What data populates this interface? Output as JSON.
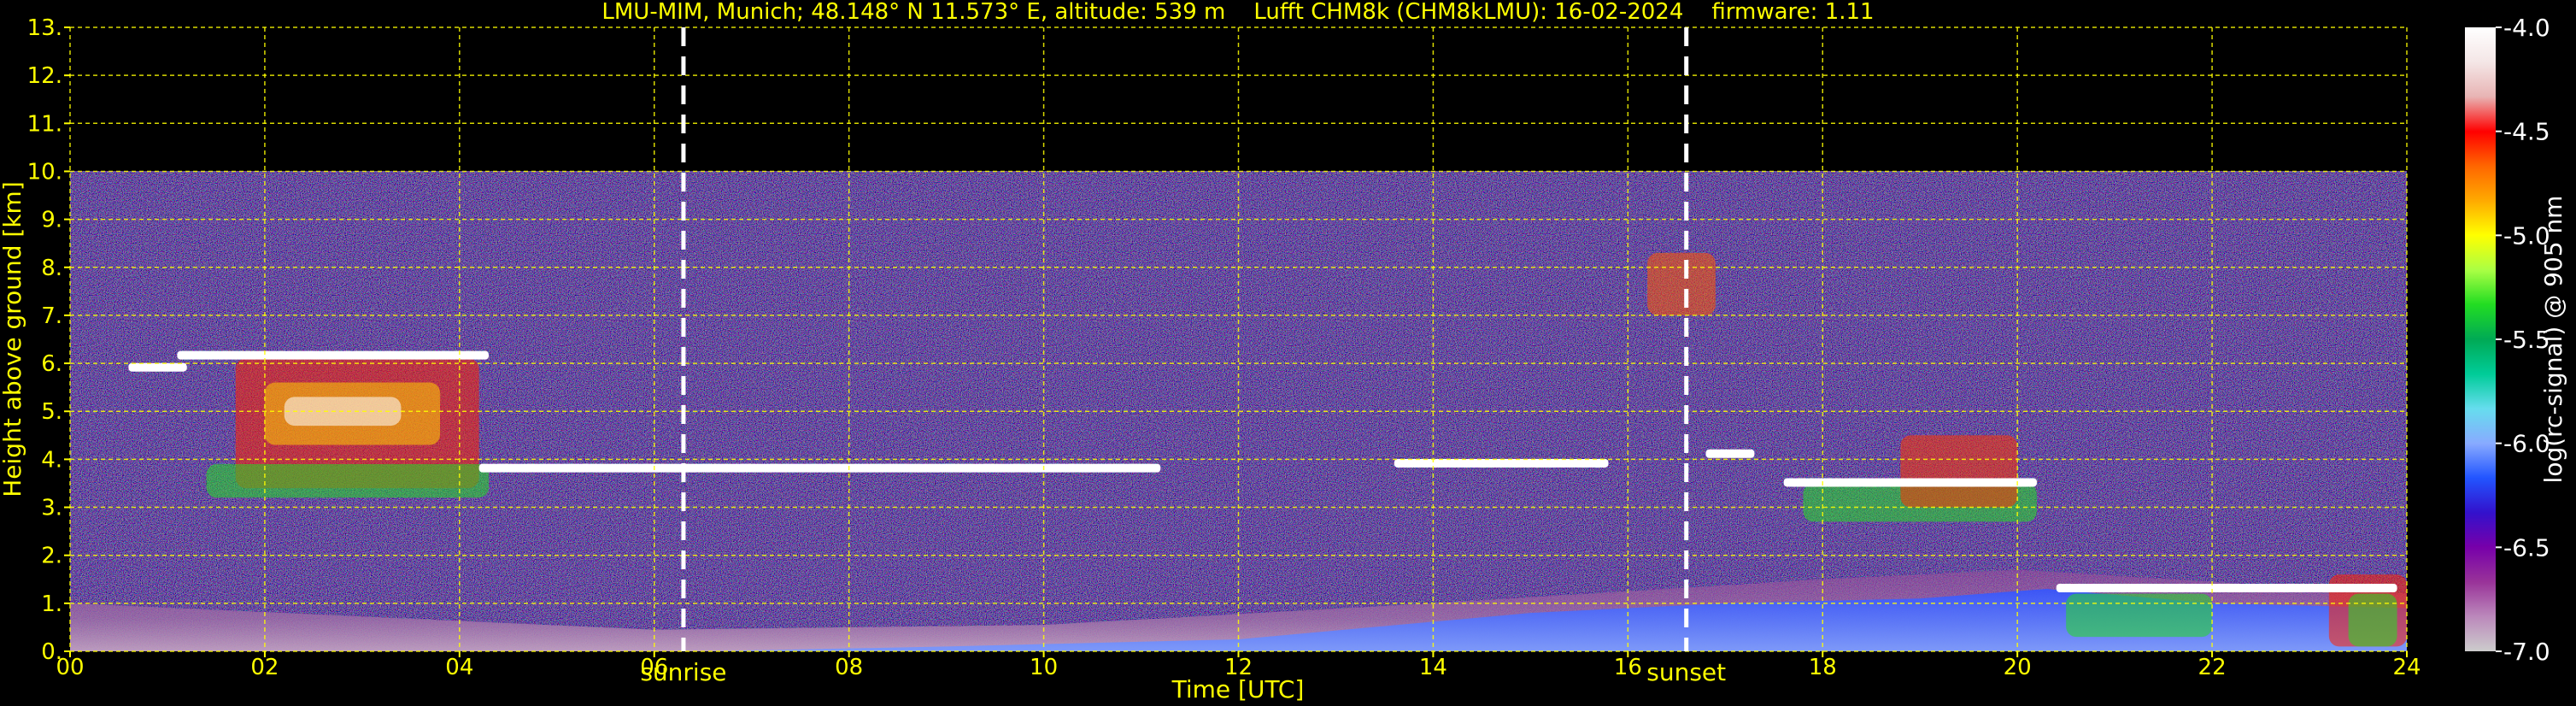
{
  "chart_data": {
    "type": "heatmap",
    "title": "LMU-MIM, Munich; 48.148° N 11.573° E, altitude: 539 m    Lufft CHM8k (CHM8kLMU): 16-02-2024    firmware: 1.11",
    "xlabel": "Time [UTC]",
    "ylabel": "Height above ground [km]",
    "xlim": [
      0,
      24
    ],
    "ylim": [
      0,
      13
    ],
    "x_ticks": [
      "00",
      "02",
      "04",
      "06",
      "08",
      "10",
      "12",
      "14",
      "16",
      "18",
      "20",
      "22",
      "24"
    ],
    "y_ticks": [
      "0.",
      "1.",
      "2.",
      "3.",
      "4.",
      "5.",
      "6.",
      "7.",
      "8.",
      "9.",
      "10.",
      "11.",
      "12.",
      "13."
    ],
    "grid": true,
    "grid_color": "#ffff00",
    "background": "#000000",
    "data_ceiling_km": 10,
    "events": [
      {
        "label": "sunrise",
        "time": 6.3
      },
      {
        "label": "sunset",
        "time": 16.6
      }
    ],
    "colorbar": {
      "label": "log(rc-signal) @ 905 nm",
      "range": [
        -7.0,
        -4.0
      ],
      "ticks": [
        "-4.0",
        "-4.5",
        "-5.0",
        "-5.5",
        "-6.0",
        "-6.5",
        "-7.0"
      ],
      "colors": [
        "#ffffff",
        "#f4e6e6",
        "#e8b4b4",
        "#ff0000",
        "#ff6600",
        "#ffaa00",
        "#ffff00",
        "#aaff44",
        "#22dd22",
        "#00aa55",
        "#00cc99",
        "#66ddee",
        "#88aaff",
        "#2255ff",
        "#3311cc",
        "#7700aa",
        "#993399",
        "#bb88bb",
        "#cccccc"
      ]
    },
    "cloud_layers": [
      {
        "t_start": 0.6,
        "t_end": 1.2,
        "height_km": 5.9
      },
      {
        "t_start": 1.1,
        "t_end": 4.3,
        "height_km": 6.15
      },
      {
        "t_start": 4.2,
        "t_end": 11.2,
        "height_km": 3.8
      },
      {
        "t_start": 13.6,
        "t_end": 15.8,
        "height_km": 3.9
      },
      {
        "t_start": 16.8,
        "t_end": 17.3,
        "height_km": 4.1
      },
      {
        "t_start": 17.6,
        "t_end": 20.2,
        "height_km": 3.5
      },
      {
        "t_start": 20.4,
        "t_end": 23.9,
        "height_km": 1.3
      }
    ],
    "boundary_layer": [
      {
        "t": 0,
        "top_km": 1.0
      },
      {
        "t": 6,
        "top_km": 0.45
      },
      {
        "t": 10,
        "top_km": 0.55
      },
      {
        "t": 14,
        "top_km": 1.0
      },
      {
        "t": 18,
        "top_km": 1.5
      },
      {
        "t": 20,
        "top_km": 1.7
      },
      {
        "t": 24,
        "top_km": 1.2
      }
    ]
  }
}
